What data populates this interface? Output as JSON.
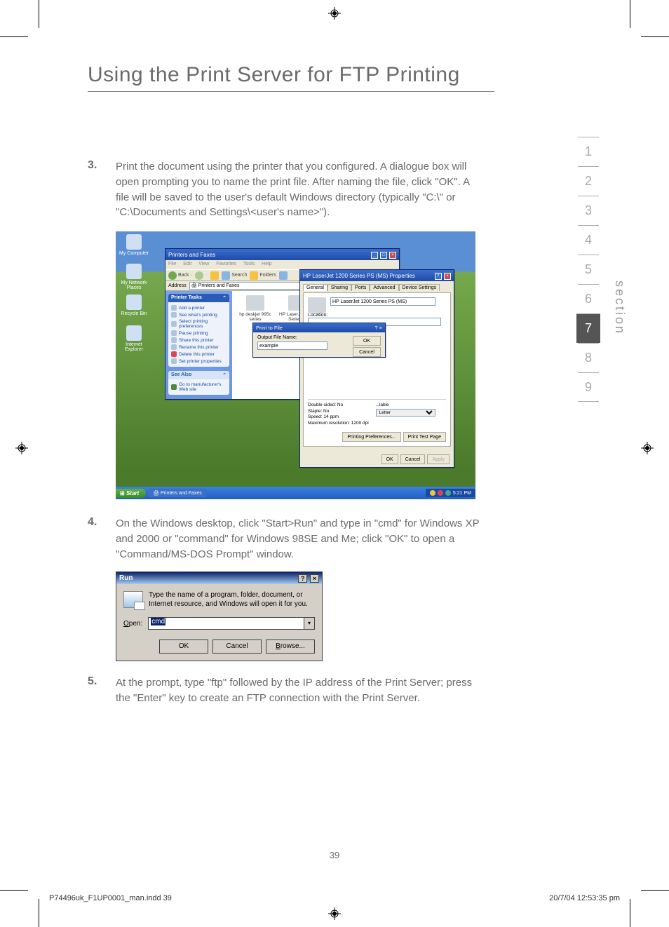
{
  "page": {
    "title": "Using the Print Server for FTP Printing",
    "number": "39",
    "footer_left": "P74496uk_F1UP0001_man.indd   39",
    "footer_right": "20/7/04   12:53:35 pm",
    "section_label": "section"
  },
  "sections": [
    "1",
    "2",
    "3",
    "4",
    "5",
    "6",
    "7",
    "8",
    "9"
  ],
  "active_section": "7",
  "steps": {
    "s3": {
      "num": "3.",
      "text": "Print the document using the printer that you configured. A dialogue box will open prompting you to name the print file. After naming the file, click \"OK\". A file will be saved to the user's default Windows directory (typically \"C:\\\" or \"C:\\Documents and Settings\\<user's name>\")."
    },
    "s4": {
      "num": "4.",
      "text": "On the Windows desktop, click \"Start>Run\" and type in \"cmd\" for Windows XP and 2000 or \"command\" for Windows 98SE and Me; click \"OK\" to open a \"Command/MS-DOS Prompt\" window."
    },
    "s5": {
      "num": "5.",
      "text": "At the prompt, type \"ftp\" followed by the IP address of the Print Server; press the \"Enter\" key to create an FTP connection with the Print Server."
    }
  },
  "xp": {
    "desktop_icons": [
      "My Computer",
      "My Network Places",
      "Recycle Bin",
      "Internet Explorer"
    ],
    "printers_window": {
      "title": "Printers and Faxes",
      "menu": [
        "File",
        "Edit",
        "View",
        "Favorites",
        "Tools",
        "Help"
      ],
      "toolbar": {
        "back": "Back",
        "search": "Search",
        "folders": "Folders"
      },
      "address_label": "Address",
      "address_value": "Printers and Faxes",
      "printer_tasks": {
        "header": "Printer Tasks",
        "items": [
          "Add a printer",
          "See what's printing",
          "Select printing preferences",
          "Pause printing",
          "Share this printer",
          "Rename this printer",
          "Delete this printer",
          "Set printer properties"
        ]
      },
      "see_also": {
        "header": "See Also",
        "items": [
          "Go to manufacturer's Web site"
        ]
      },
      "printers": [
        {
          "name": "hp deskjet 995c series"
        },
        {
          "name": "HP LaserJet 1200 Series ..."
        }
      ]
    },
    "properties_window": {
      "title": "HP LaserJet 1200 Series PS (MS) Properties",
      "tabs": [
        "General",
        "Sharing",
        "Ports",
        "Advanced",
        "Device Settings"
      ],
      "name_value": "HP LaserJet 1200 Series PS (MS)",
      "location_label": "Location:",
      "features": {
        "double": "Double-sided: No",
        "staple": "Staple: No",
        "speed": "Speed: 14 ppm",
        "res": "Maximum resolution: 1200 dpi",
        "paper": "Letter",
        "paper_label": "...lable"
      },
      "btn_pref": "Printing Preferences...",
      "btn_test": "Print Test Page",
      "btn_ok": "OK",
      "btn_cancel": "Cancel",
      "btn_apply": "Apply"
    },
    "print_to_file": {
      "title": "Print to File",
      "label": "Output File Name:",
      "value": "example",
      "ok": "OK",
      "cancel": "Cancel"
    },
    "taskbar": {
      "start": "Start",
      "task": "Printers and Faxes",
      "time": "5:21 PM"
    }
  },
  "run": {
    "title": "Run",
    "desc": "Type the name of a program, folder, document, or Internet resource, and Windows will open it for you.",
    "open_label": "Open:",
    "value": "cmd",
    "ok": "OK",
    "cancel": "Cancel",
    "browse": "Browse..."
  }
}
